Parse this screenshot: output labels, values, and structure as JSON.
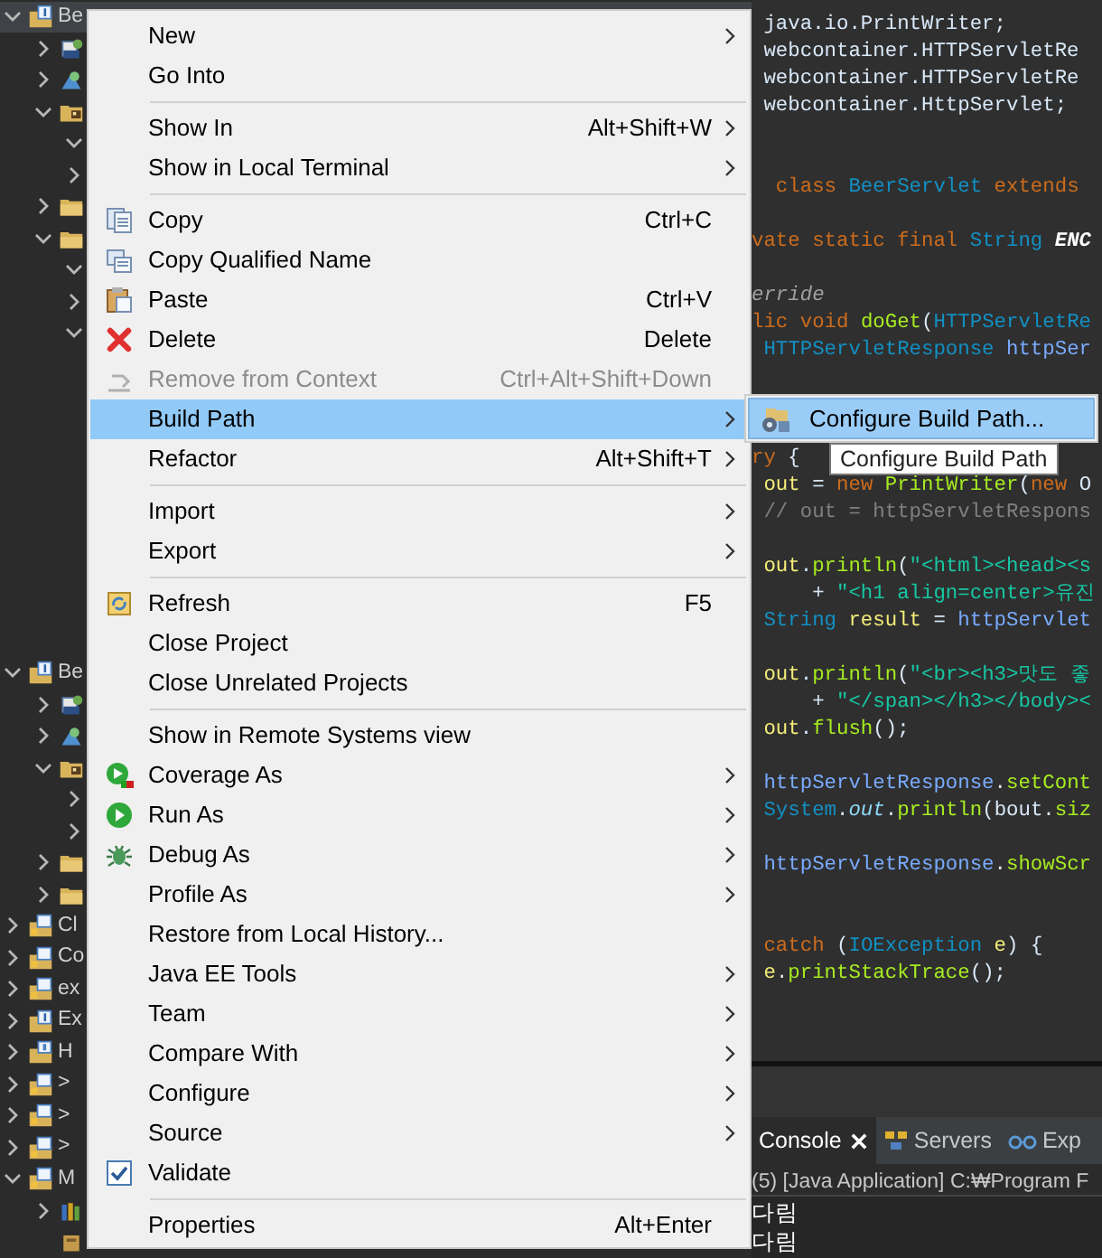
{
  "explorer": {
    "tree": [
      {
        "label": "Be",
        "kind": "project",
        "expanded": true,
        "selected": true,
        "children": [
          {
            "kind": "jar",
            "expanded": false
          },
          {
            "kind": "library",
            "expanded": false
          },
          {
            "kind": "webapp",
            "expanded": true,
            "children": [
              {
                "expanded": true
              },
              {
                "expanded": false
              }
            ]
          },
          {
            "kind": "folder",
            "expanded": false
          },
          {
            "kind": "folder",
            "expanded": true,
            "children": [
              {
                "expanded": true
              },
              {
                "expanded": false
              },
              {
                "expanded": true
              }
            ]
          }
        ]
      },
      {
        "label": "Be",
        "kind": "project",
        "expanded": true,
        "selected": false,
        "children": [
          {
            "kind": "jar",
            "expanded": false
          },
          {
            "kind": "library",
            "expanded": false
          },
          {
            "kind": "webapp",
            "expanded": true,
            "children": [
              {
                "expanded": false
              },
              {
                "expanded": false
              }
            ]
          },
          {
            "kind": "folder",
            "expanded": false
          },
          {
            "kind": "folder",
            "expanded": false
          }
        ]
      },
      {
        "label": "Cl",
        "kind": "closed",
        "expanded": false,
        "selected": false
      },
      {
        "label": "Co",
        "kind": "closed",
        "expanded": false,
        "selected": false
      },
      {
        "label": "ex",
        "kind": "closed",
        "expanded": false,
        "selected": false
      },
      {
        "label": "Ex",
        "kind": "project",
        "expanded": false,
        "selected": false
      },
      {
        "label": "H",
        "kind": "error",
        "expanded": false,
        "selected": false
      },
      {
        "label": ">",
        "kind": "closed",
        "expanded": false,
        "selected": false
      },
      {
        "label": ">",
        "kind": "closed",
        "expanded": false,
        "selected": false
      },
      {
        "label": ">",
        "kind": "closed",
        "expanded": false,
        "selected": false
      },
      {
        "label": "M",
        "kind": "closed",
        "expanded": true,
        "selected": false,
        "children": [
          {
            "kind": "books",
            "expanded": false
          },
          {
            "kind": "file"
          }
        ]
      }
    ]
  },
  "editor": {
    "lines": [
      {
        "kind": "code",
        "tokens": [
          {
            "text": " java.io.PrintWriter;",
            "kind": "plain"
          }
        ]
      },
      {
        "kind": "code",
        "tokens": [
          {
            "text": " webcontainer.HTTPServletRe",
            "kind": "plain"
          }
        ]
      },
      {
        "kind": "code",
        "tokens": [
          {
            "text": " webcontainer.HTTPServletRe",
            "kind": "plain"
          }
        ]
      },
      {
        "kind": "code",
        "tokens": [
          {
            "text": " webcontainer.HttpServlet;",
            "kind": "plain"
          }
        ]
      },
      {
        "kind": "blank"
      },
      {
        "kind": "blank"
      },
      {
        "kind": "code",
        "tokens": [
          {
            "text": "  class ",
            "kind": "keyword"
          },
          {
            "text": "BeerServlet",
            "kind": "type"
          },
          {
            "text": " extends",
            "kind": "keyword"
          }
        ]
      },
      {
        "kind": "blank"
      },
      {
        "kind": "code",
        "tokens": [
          {
            "text": "vate static final ",
            "kind": "keyword"
          },
          {
            "text": "String ",
            "kind": "type"
          },
          {
            "text": "ENC",
            "kind": "constant"
          }
        ]
      },
      {
        "kind": "blank"
      },
      {
        "kind": "code",
        "tokens": [
          {
            "text": "erride",
            "kind": "annotation"
          }
        ]
      },
      {
        "kind": "code",
        "tokens": [
          {
            "text": "lic void ",
            "kind": "keyword"
          },
          {
            "text": "doGet",
            "kind": "method"
          },
          {
            "text": "(",
            "kind": "plain"
          },
          {
            "text": "HTTPServletRe",
            "kind": "type"
          }
        ]
      },
      {
        "kind": "code",
        "tokens": [
          {
            "text": " HTTPServletResponse ",
            "kind": "type"
          },
          {
            "text": "httpSer",
            "kind": "param"
          }
        ]
      },
      {
        "kind": "blank"
      },
      {
        "kind": "blank"
      },
      {
        "kind": "blank"
      },
      {
        "kind": "code",
        "tokens": [
          {
            "text": "ry",
            "kind": "keyword"
          },
          {
            "text": " {",
            "kind": "plain"
          }
        ]
      },
      {
        "kind": "code",
        "tokens": [
          {
            "text": " out",
            "kind": "variable"
          },
          {
            "text": " = ",
            "kind": "plain"
          },
          {
            "text": "new ",
            "kind": "keyword"
          },
          {
            "text": "PrintWriter",
            "kind": "method"
          },
          {
            "text": "(",
            "kind": "plain"
          },
          {
            "text": "new ",
            "kind": "keyword"
          },
          {
            "text": "O",
            "kind": "plain"
          }
        ]
      },
      {
        "kind": "code",
        "tokens": [
          {
            "text": " // out = httpServletRespons",
            "kind": "comment"
          }
        ]
      },
      {
        "kind": "blank"
      },
      {
        "kind": "code",
        "tokens": [
          {
            "text": " out",
            "kind": "variable"
          },
          {
            "text": ".",
            "kind": "plain"
          },
          {
            "text": "println",
            "kind": "method"
          },
          {
            "text": "(",
            "kind": "plain"
          },
          {
            "text": "\"<html><head><s",
            "kind": "string"
          }
        ]
      },
      {
        "kind": "code",
        "tokens": [
          {
            "text": "     + ",
            "kind": "plain"
          },
          {
            "text": "\"<h1 align=center>유진",
            "kind": "string"
          }
        ]
      },
      {
        "kind": "code",
        "tokens": [
          {
            "text": " String",
            "kind": "type"
          },
          {
            "text": " result",
            "kind": "variable"
          },
          {
            "text": " = ",
            "kind": "plain"
          },
          {
            "text": "httpServlet",
            "kind": "param"
          }
        ]
      },
      {
        "kind": "blank"
      },
      {
        "kind": "code",
        "tokens": [
          {
            "text": " out",
            "kind": "variable"
          },
          {
            "text": ".",
            "kind": "plain"
          },
          {
            "text": "println",
            "kind": "method"
          },
          {
            "text": "(",
            "kind": "plain"
          },
          {
            "text": "\"<br><h3>맛도 좋",
            "kind": "string"
          }
        ]
      },
      {
        "kind": "code",
        "tokens": [
          {
            "text": "     + ",
            "kind": "plain"
          },
          {
            "text": "\"</span></h3></body><",
            "kind": "string"
          }
        ]
      },
      {
        "kind": "code",
        "tokens": [
          {
            "text": " out",
            "kind": "variable"
          },
          {
            "text": ".",
            "kind": "plain"
          },
          {
            "text": "flush",
            "kind": "method"
          },
          {
            "text": "();",
            "kind": "plain"
          }
        ]
      },
      {
        "kind": "blank"
      },
      {
        "kind": "code",
        "tokens": [
          {
            "text": " httpServletResponse",
            "kind": "param"
          },
          {
            "text": ".",
            "kind": "plain"
          },
          {
            "text": "setCont",
            "kind": "method"
          }
        ]
      },
      {
        "kind": "code",
        "tokens": [
          {
            "text": " System",
            "kind": "type"
          },
          {
            "text": ".",
            "kind": "plain"
          },
          {
            "text": "out",
            "kind": "field"
          },
          {
            "text": ".",
            "kind": "plain"
          },
          {
            "text": "println",
            "kind": "method"
          },
          {
            "text": "(",
            "kind": "plain"
          },
          {
            "text": "bout",
            "kind": "plain"
          },
          {
            "text": ".",
            "kind": "plain"
          },
          {
            "text": "siz",
            "kind": "method"
          }
        ]
      },
      {
        "kind": "blank"
      },
      {
        "kind": "code",
        "tokens": [
          {
            "text": " httpServletResponse",
            "kind": "param"
          },
          {
            "text": ".",
            "kind": "plain"
          },
          {
            "text": "showScr",
            "kind": "method"
          }
        ]
      },
      {
        "kind": "blank"
      },
      {
        "kind": "blank"
      },
      {
        "kind": "code",
        "tokens": [
          {
            "text": " catch",
            "kind": "keyword"
          },
          {
            "text": " (",
            "kind": "plain"
          },
          {
            "text": "IOException",
            "kind": "type"
          },
          {
            "text": " e",
            "kind": "variable"
          },
          {
            "text": ") {",
            "kind": "plain"
          }
        ]
      },
      {
        "kind": "code",
        "tokens": [
          {
            "text": " e",
            "kind": "variable"
          },
          {
            "text": ".",
            "kind": "plain"
          },
          {
            "text": "printStackTrace",
            "kind": "method"
          },
          {
            "text": "();",
            "kind": "plain"
          }
        ]
      }
    ]
  },
  "console": {
    "tabs": [
      {
        "label": "Console",
        "selected": true,
        "closable": true,
        "kind": "console"
      },
      {
        "label": "Servers",
        "selected": false,
        "closable": false,
        "kind": "servers"
      },
      {
        "label": "Exp",
        "selected": false,
        "closable": false,
        "kind": "explorer"
      }
    ],
    "status": "(5) [Java Application] C:₩Program F",
    "output": [
      "다림",
      "다림"
    ]
  },
  "context_menu": {
    "items": [
      {
        "kind": "item",
        "label": "New",
        "submenu": true,
        "disabled": false,
        "selected": false
      },
      {
        "kind": "item",
        "label": "Go Into",
        "submenu": false,
        "disabled": false,
        "selected": false
      },
      {
        "kind": "separator"
      },
      {
        "kind": "item",
        "label": "Show In",
        "shortcut": "Alt+Shift+W",
        "submenu": true,
        "disabled": false,
        "selected": false
      },
      {
        "kind": "item",
        "label": "Show in Local Terminal",
        "submenu": true,
        "disabled": false,
        "selected": false
      },
      {
        "kind": "separator"
      },
      {
        "kind": "copy",
        "label": "Copy",
        "shortcut": "Ctrl+C",
        "submenu": false,
        "disabled": false,
        "selected": false
      },
      {
        "kind": "copy-name",
        "label": "Copy Qualified Name",
        "submenu": false,
        "disabled": false,
        "selected": false
      },
      {
        "kind": "paste",
        "label": "Paste",
        "shortcut": "Ctrl+V",
        "submenu": false,
        "disabled": false,
        "selected": false
      },
      {
        "kind": "delete",
        "label": "Delete",
        "shortcut": "Delete",
        "submenu": false,
        "disabled": false,
        "selected": false
      },
      {
        "kind": "remove",
        "label": "Remove from Context",
        "shortcut": "Ctrl+Alt+Shift+Down",
        "submenu": false,
        "disabled": true,
        "selected": false
      },
      {
        "kind": "item",
        "label": "Build Path",
        "submenu": true,
        "disabled": false,
        "selected": true
      },
      {
        "kind": "item",
        "label": "Refactor",
        "shortcut": "Alt+Shift+T",
        "submenu": true,
        "disabled": false,
        "selected": false
      },
      {
        "kind": "separator"
      },
      {
        "kind": "item",
        "label": "Import",
        "submenu": true,
        "disabled": false,
        "selected": false
      },
      {
        "kind": "item",
        "label": "Export",
        "submenu": true,
        "disabled": false,
        "selected": false
      },
      {
        "kind": "separator"
      },
      {
        "kind": "refresh",
        "label": "Refresh",
        "shortcut": "F5",
        "submenu": false,
        "disabled": false,
        "selected": false
      },
      {
        "kind": "item",
        "label": "Close Project",
        "submenu": false,
        "disabled": false,
        "selected": false
      },
      {
        "kind": "item",
        "label": "Close Unrelated Projects",
        "submenu": false,
        "disabled": false,
        "selected": false
      },
      {
        "kind": "separator"
      },
      {
        "kind": "item",
        "label": "Show in Remote Systems view",
        "submenu": false,
        "disabled": false,
        "selected": false
      },
      {
        "kind": "coverage",
        "label": "Coverage As",
        "submenu": true,
        "disabled": false,
        "selected": false
      },
      {
        "kind": "run",
        "label": "Run As",
        "submenu": true,
        "disabled": false,
        "selected": false
      },
      {
        "kind": "debug",
        "label": "Debug As",
        "submenu": true,
        "disabled": false,
        "selected": false
      },
      {
        "kind": "item",
        "label": "Profile As",
        "submenu": true,
        "disabled": false,
        "selected": false
      },
      {
        "kind": "item",
        "label": "Restore from Local History...",
        "submenu": false,
        "disabled": false,
        "selected": false
      },
      {
        "kind": "item",
        "label": "Java EE Tools",
        "submenu": true,
        "disabled": false,
        "selected": false
      },
      {
        "kind": "item",
        "label": "Team",
        "submenu": true,
        "disabled": false,
        "selected": false
      },
      {
        "kind": "item",
        "label": "Compare With",
        "submenu": true,
        "disabled": false,
        "selected": false
      },
      {
        "kind": "item",
        "label": "Configure",
        "submenu": true,
        "disabled": false,
        "selected": false
      },
      {
        "kind": "item",
        "label": "Source",
        "submenu": true,
        "disabled": false,
        "selected": false
      },
      {
        "kind": "validate",
        "label": "Validate",
        "submenu": false,
        "disabled": false,
        "selected": false
      },
      {
        "kind": "separator"
      },
      {
        "kind": "item",
        "label": "Properties",
        "shortcut": "Alt+Enter",
        "submenu": false,
        "disabled": false,
        "selected": false
      }
    ]
  },
  "submenu": {
    "items": [
      {
        "label": "Configure Build Path...",
        "selected": true
      }
    ]
  },
  "tooltip": {
    "text": "Configure Build Path"
  }
}
